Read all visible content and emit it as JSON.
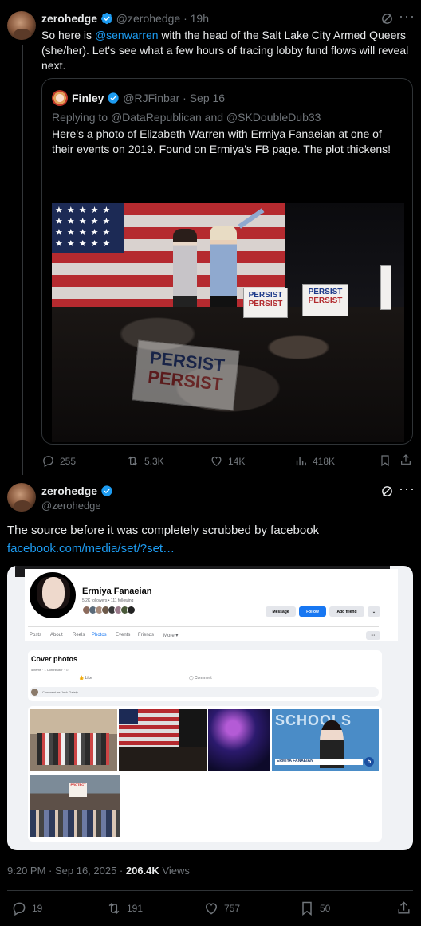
{
  "main_tweet": {
    "display_name": "zerohedge",
    "handle": "@zerohedge",
    "time": "19h",
    "text_before": "So here is ",
    "mention": "@senwarren",
    "text_after": " with the head of the Salt Lake City Armed Queers (she/her). Let's see what a few hours of tracing lobby fund flows will reveal next.",
    "quoted": {
      "display_name": "Finley",
      "handle": "@RJFinbar",
      "date": "Sep 16",
      "replying_prefix": "Replying to ",
      "replying_1": "@DataRepublican",
      "replying_and": " and ",
      "replying_2": "@SKDoubleDub33",
      "text": "Here's a photo of Elizabeth Warren with Ermiya Fanaeian at one of their events on 2019. Found on Ermiya's FB page. The plot thickens!",
      "signs": [
        "PERSIST",
        "PERSIST",
        "PERSIST"
      ]
    },
    "stats": {
      "replies": "255",
      "reposts": "5.3K",
      "likes": "14K",
      "views": "418K"
    }
  },
  "reply_tweet": {
    "display_name": "zerohedge",
    "handle": "@zerohedge",
    "text": "The source before it was completely scrubbed by facebook",
    "link": "facebook.com/media/set/?set…",
    "fb_shot": {
      "profile_name": "Ermiya Fanaeian",
      "followers": "5.2K followers • 111 following",
      "message_btn": "Message",
      "follow_btn": "Follow",
      "add_friend_btn": "Add friend",
      "tabs": [
        "Posts",
        "About",
        "Reels",
        "Photos",
        "Events",
        "Friends",
        "More ▾"
      ],
      "album_title": "Cover photos",
      "album_meta": "5 items · 1 Contributor · ☺",
      "like": "Like",
      "comment": "Comment",
      "comment_placeholder": "Comment as Jack Gately",
      "tv_banner": "ERMIYA FANAEIAN",
      "tv_bg": "SCHOOLS",
      "protest_sign": "PROTECT"
    },
    "timestamp": "9:20 PM · Sep 16, 2025 · ",
    "views_count": "206.4K",
    "views_label": " Views",
    "stats": {
      "replies": "19",
      "reposts": "191",
      "likes": "757",
      "bookmarks": "50"
    }
  },
  "colors": {
    "accent": "#1d9bf0",
    "muted": "#71767b",
    "border": "#2f3336",
    "fb_blue": "#1877f2"
  }
}
